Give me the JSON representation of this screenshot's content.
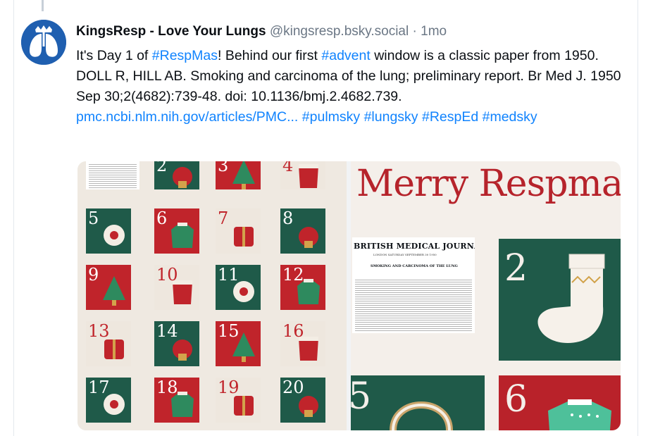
{
  "post": {
    "display_name": "KingsResp - Love Your Lungs",
    "handle": "@kingsresp.bsky.social",
    "separator": "·",
    "time": "1mo",
    "text": {
      "t1": "It's Day 1 of ",
      "tag_respmas": "#RespMas",
      "t2": "! Behind our first ",
      "tag_advent": "#advent",
      "t3": " window is a classic paper from 1950. DOLL R, HILL AB. Smoking and carcinoma of the lung; preliminary report. Br Med J. 1950 Sep 30;2(4682):739-48. doi: 10.1136/bmj.2.4682.739. ",
      "link": "pmc.ncbi.nlm.nih.gov/articles/PMC...",
      "t4": " ",
      "tag_pulmsky": "#pulmsky",
      "tag_lungsky": "#lungsky",
      "tag_resped": "#RespEd",
      "tag_medsky": "#medsky"
    }
  },
  "image1": {
    "tiles": [
      {
        "num": "2",
        "icon": "sock-icon"
      },
      {
        "num": "3",
        "icon": "tree-icon"
      },
      {
        "num": "4",
        "icon": "hat-icon"
      },
      {
        "num": "5",
        "icon": "earmuffs-icon"
      },
      {
        "num": "6",
        "icon": "sweater-icon"
      },
      {
        "num": "7",
        "icon": "cardinal-icon"
      },
      {
        "num": "8",
        "icon": "pinecone-icon"
      },
      {
        "num": "9",
        "icon": "bobble-hat-icon"
      },
      {
        "num": "10",
        "icon": "ice-skate-icon"
      },
      {
        "num": "11",
        "icon": "mitten-icon"
      },
      {
        "num": "12",
        "icon": "snowflake-icon"
      },
      {
        "num": "13",
        "icon": "mug-icon"
      },
      {
        "num": "14",
        "icon": "candle-icon"
      },
      {
        "num": "15",
        "icon": "christmas-tree-icon"
      },
      {
        "num": "16",
        "icon": "fox-icon"
      },
      {
        "num": "17",
        "icon": "gift-icon"
      },
      {
        "num": "18",
        "icon": "owl-icon"
      },
      {
        "num": "19",
        "icon": "mulled-wine-icon"
      },
      {
        "num": "20",
        "icon": "berries-icon"
      }
    ]
  },
  "image2": {
    "heading": "Merry Respmas",
    "journal_title": "BRITISH MEDICAL JOURNAL",
    "journal_sub": "LONDON SATURDAY SEPTEMBER 30 1950",
    "article_title": "SMOKING AND CARCINOMA OF THE LUNG",
    "tile_numbers": [
      "2",
      "5",
      "6"
    ]
  },
  "colors": {
    "green": "#1f5a49",
    "red": "#c0242b",
    "cream": "#eee7de",
    "link": "#1083fe",
    "muted": "#6b7785"
  }
}
